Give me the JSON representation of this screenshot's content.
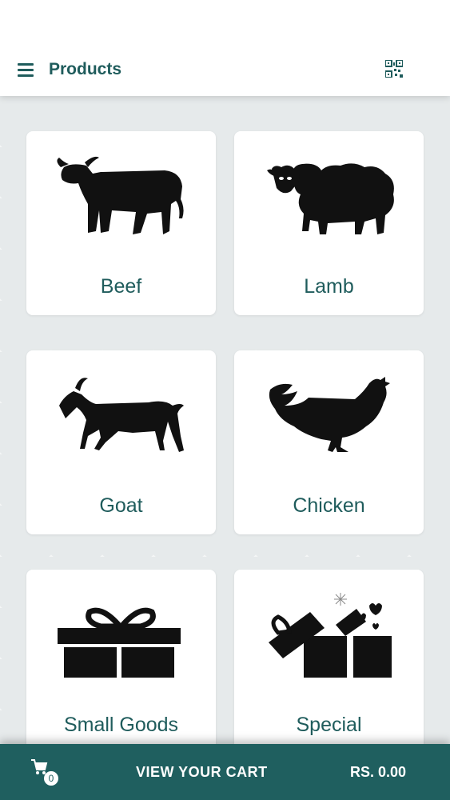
{
  "header": {
    "title": "Products",
    "icons": {
      "menu": "hamburger-menu-icon",
      "qr": "qr-code-icon"
    }
  },
  "products": [
    {
      "label": "Beef",
      "icon": "cow-icon"
    },
    {
      "label": "Lamb",
      "icon": "sheep-icon"
    },
    {
      "label": "Goat",
      "icon": "goat-icon"
    },
    {
      "label": "Chicken",
      "icon": "chicken-icon"
    },
    {
      "label": "Small Goods",
      "icon": "gift-box-icon"
    },
    {
      "label": "Special",
      "icon": "open-gift-hearts-icon"
    }
  ],
  "cart": {
    "count": "0",
    "label": "VIEW YOUR CART",
    "total": "RS. 0.00",
    "icon": "shopping-cart-icon"
  },
  "colors": {
    "accent": "#1f5c5c",
    "cart_bar": "#1f5f5f",
    "background": "#e6eaeb",
    "card": "#ffffff",
    "silhouette": "#111111"
  }
}
